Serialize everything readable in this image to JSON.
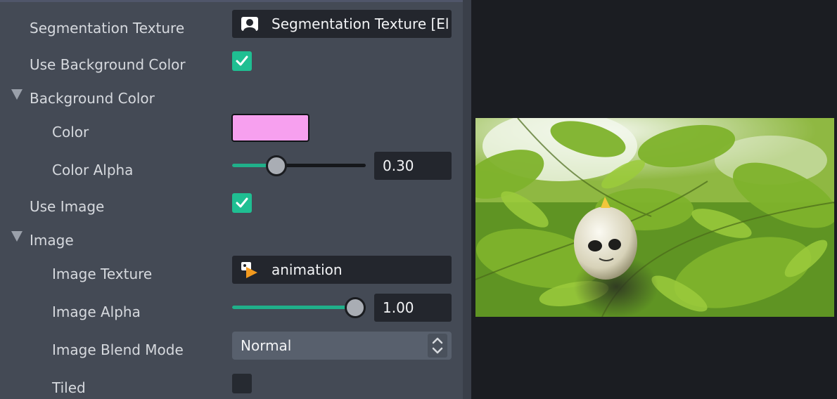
{
  "inspector": {
    "segmentation_texture": {
      "label": "Segmentation Texture",
      "value": "Segmentation Texture [El",
      "icon": "texture-portrait-icon"
    },
    "use_background_color": {
      "label": "Use Background Color",
      "checked": true
    },
    "background_color_section": {
      "label": "Background Color",
      "expanded": true
    },
    "color": {
      "label": "Color",
      "value": "#f7a0ef"
    },
    "color_alpha": {
      "label": "Color Alpha",
      "value": "0.30",
      "fraction": 0.3
    },
    "use_image": {
      "label": "Use Image",
      "checked": true
    },
    "image_section": {
      "label": "Image",
      "expanded": true
    },
    "image_texture": {
      "label": "Image Texture",
      "value": "animation",
      "icon": "animation-play-icon"
    },
    "image_alpha": {
      "label": "Image Alpha",
      "value": "1.00",
      "fraction": 1.0
    },
    "image_blend_mode": {
      "label": "Image Blend Mode",
      "value": "Normal"
    },
    "tiled": {
      "label": "Tiled",
      "checked": false
    }
  },
  "colors": {
    "panel_bg": "#444a55",
    "accent": "#1fbf92",
    "field_bg": "#23262d",
    "viewport_bg": "#1b1d22"
  },
  "preview": {
    "description_icon": "preview-image",
    "content": "photo of green maple leaves with a round white figure in the center"
  }
}
